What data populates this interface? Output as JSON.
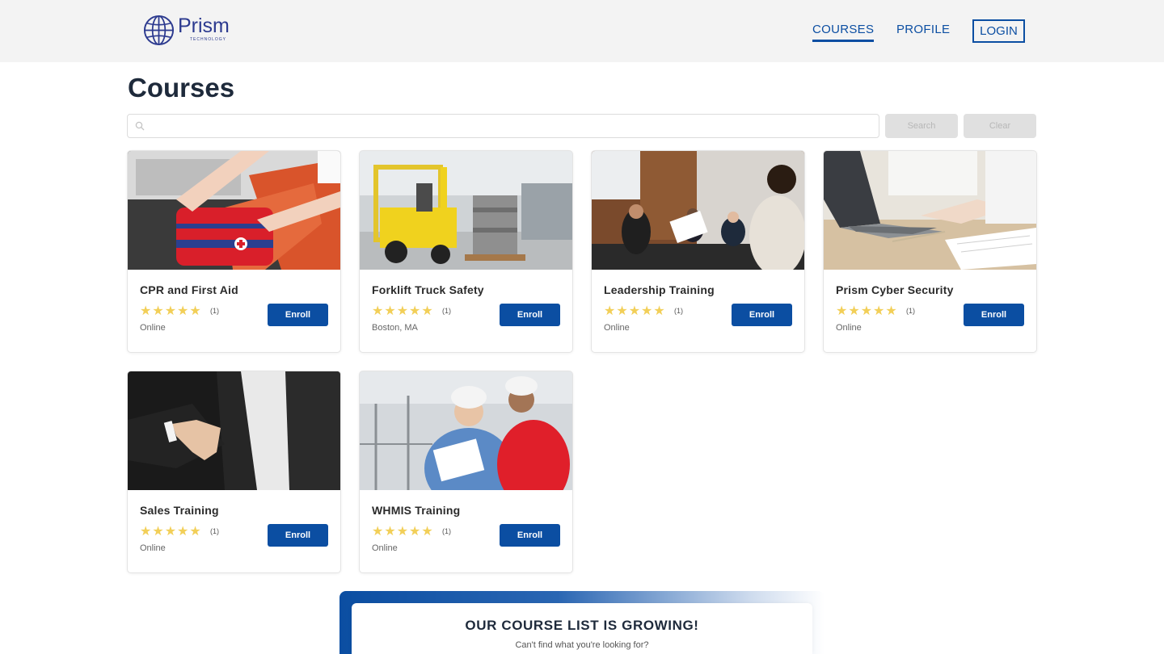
{
  "brand": {
    "name": "Prism",
    "tagline": "TECHNOLOGY"
  },
  "nav": {
    "courses": "COURSES",
    "profile": "PROFILE",
    "login": "LOGIN"
  },
  "page": {
    "title": "Courses"
  },
  "search": {
    "placeholder": "",
    "search_label": "Search",
    "clear_label": "Clear"
  },
  "courses": [
    {
      "title": "CPR and First Aid",
      "rating": 5,
      "count": "(1)",
      "location": "Online",
      "enroll": "Enroll"
    },
    {
      "title": "Forklift Truck Safety",
      "rating": 5,
      "count": "(1)",
      "location": "Boston, MA",
      "enroll": "Enroll"
    },
    {
      "title": "Leadership Training",
      "rating": 5,
      "count": "(1)",
      "location": "Online",
      "enroll": "Enroll"
    },
    {
      "title": "Prism Cyber Security",
      "rating": 5,
      "count": "(1)",
      "location": "Online",
      "enroll": "Enroll"
    },
    {
      "title": "Sales Training",
      "rating": 5,
      "count": "(1)",
      "location": "Online",
      "enroll": "Enroll"
    },
    {
      "title": "WHMIS Training",
      "rating": 5,
      "count": "(1)",
      "location": "Online",
      "enroll": "Enroll"
    }
  ],
  "banner": {
    "title": "OUR COURSE LIST IS GROWING!",
    "subtitle": "Can't find what you're looking for?"
  },
  "colors": {
    "primary": "#0b4ea2",
    "star": "#f2cf58",
    "navbar": "#f3f3f3"
  }
}
